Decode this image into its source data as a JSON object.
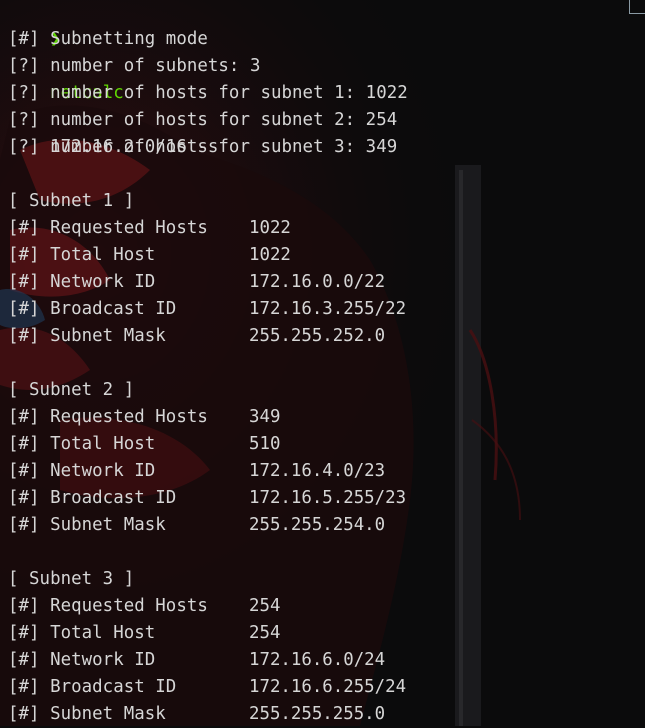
{
  "prompt": {
    "arrow": "❯",
    "command": "netcalc",
    "args": "172.16.2.0/16 -s"
  },
  "intro": [
    "[#] Subnetting mode",
    "[?] number of subnets: 3",
    "[?] number of hosts for subnet 1: 1022",
    "[?] number of hosts for subnet 2: 254",
    "[?] number of hosts for subnet 3: 349"
  ],
  "subnets": [
    {
      "header": "[ Subnet 1 ]",
      "rows": [
        {
          "label": "[#] Requested Hosts",
          "value": "1022"
        },
        {
          "label": "[#] Total Host",
          "value": "1022"
        },
        {
          "label": "[#] Network ID",
          "value": "172.16.0.0/22"
        },
        {
          "label": "[#] Broadcast ID",
          "value": "172.16.3.255/22"
        },
        {
          "label": "[#] Subnet Mask",
          "value": "255.255.252.0"
        }
      ]
    },
    {
      "header": "[ Subnet 2 ]",
      "rows": [
        {
          "label": "[#] Requested Hosts",
          "value": "349"
        },
        {
          "label": "[#] Total Host",
          "value": "510"
        },
        {
          "label": "[#] Network ID",
          "value": "172.16.4.0/23"
        },
        {
          "label": "[#] Broadcast ID",
          "value": "172.16.5.255/23"
        },
        {
          "label": "[#] Subnet Mask",
          "value": "255.255.254.0"
        }
      ]
    },
    {
      "header": "[ Subnet 3 ]",
      "rows": [
        {
          "label": "[#] Requested Hosts",
          "value": "254"
        },
        {
          "label": "[#] Total Host",
          "value": "254"
        },
        {
          "label": "[#] Network ID",
          "value": "172.16.6.0/24"
        },
        {
          "label": "[#] Broadcast ID",
          "value": "172.16.6.255/24"
        },
        {
          "label": "[#] Subnet Mask",
          "value": "255.255.255.0"
        }
      ]
    }
  ],
  "colors": {
    "background": "#0b0b0c",
    "text": "#d6d6d6",
    "prompt_green": "#5fd700"
  }
}
